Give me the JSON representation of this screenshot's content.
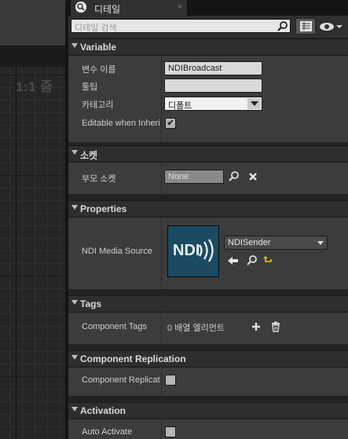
{
  "viewport": {
    "zoom_label": "1:1 줌"
  },
  "tab": {
    "icon": "magnifier-icon",
    "label": "디테일",
    "close": "×"
  },
  "search": {
    "placeholder": "디테일 검색"
  },
  "sections": {
    "variable": {
      "title": "Variable",
      "var_name_label": "변수 이름",
      "var_name_value": "NDIBroadcast",
      "tooltip_label": "툴팁",
      "tooltip_value": "",
      "category_label": "카테고리",
      "category_value": "디폴트",
      "editable_label": "Editable when Inherit",
      "editable_checked": true
    },
    "socket": {
      "title": "소켓",
      "parent_socket_label": "부모 소켓",
      "parent_socket_value": "None"
    },
    "properties": {
      "title": "Properties",
      "ndi_label": "NDI Media Source",
      "thumbnail_text": "NDI",
      "asset_value": "NDISender"
    },
    "tags": {
      "title": "Tags",
      "component_tags_label": "Component Tags",
      "component_tags_value": "0 배열 엘리먼트"
    },
    "replication": {
      "title": "Component Replication",
      "replicates_label": "Component Replicat",
      "replicates_checked": false
    },
    "activation": {
      "title": "Activation",
      "auto_activate_label": "Auto Activate",
      "auto_activate_checked": false
    }
  },
  "colors": {
    "panel_bg": "#3c3c3c",
    "header_bg": "#2e2e2e",
    "thumb_bg": "#1b4a63",
    "accent_yellow": "#e8d000"
  }
}
